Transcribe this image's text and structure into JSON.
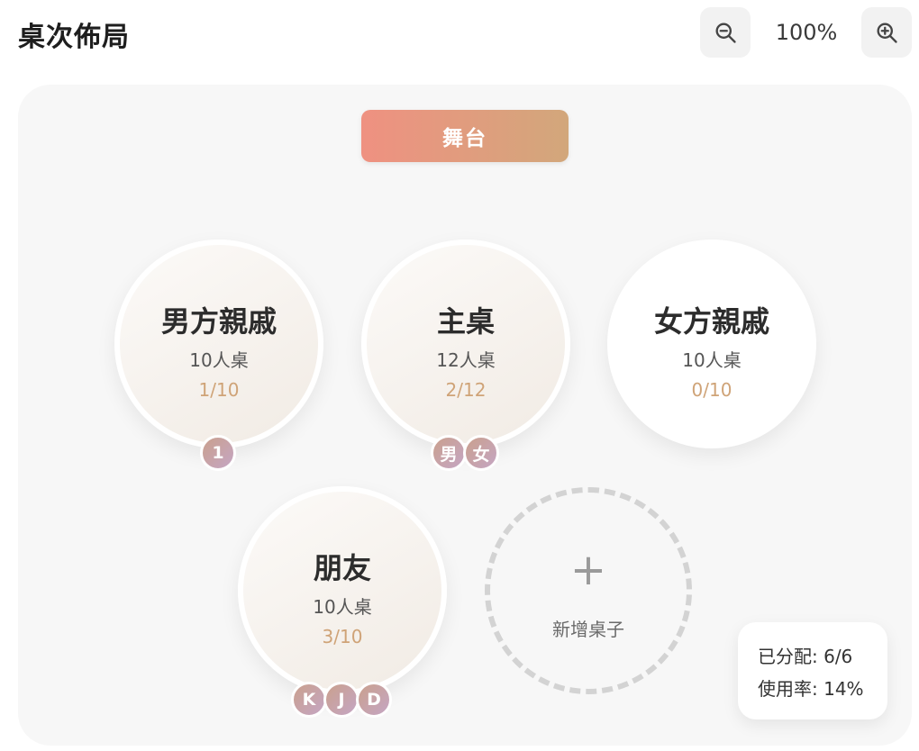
{
  "header": {
    "title": "桌次佈局",
    "zoom_level": "100%",
    "zoom_out_icon": "zoom-out-icon",
    "zoom_in_icon": "zoom-in-icon"
  },
  "stage": {
    "label": "舞台"
  },
  "tables": [
    {
      "name": "男方親戚",
      "capacity": "10人桌",
      "count": "1/10",
      "guests": [
        "1"
      ]
    },
    {
      "name": "主桌",
      "capacity": "12人桌",
      "count": "2/12",
      "guests": [
        "男",
        "女"
      ]
    },
    {
      "name": "女方親戚",
      "capacity": "10人桌",
      "count": "0/10",
      "guests": []
    },
    {
      "name": "朋友",
      "capacity": "10人桌",
      "count": "3/10",
      "guests": [
        "K",
        "J",
        "D"
      ]
    }
  ],
  "add_table": {
    "icon": "+",
    "label": "新增桌子"
  },
  "stats": {
    "assigned": "已分配: 6/6",
    "usage": "使用率: 14%"
  },
  "colors": {
    "stage_gradient_start": "#ef9181",
    "stage_gradient_end": "#d2a77b",
    "count_text": "#cfa377",
    "guest_gradient_start": "#caa08d",
    "guest_gradient_end": "#c5a6c4"
  }
}
